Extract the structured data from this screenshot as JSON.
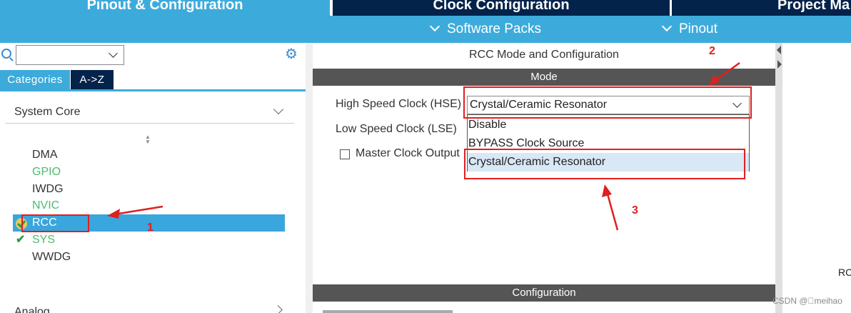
{
  "colors": {
    "nav_dark": "#03234b",
    "nav_blue": "#3cabdb",
    "selection": "#39a6dd",
    "tab_active": "#3cabdb",
    "tab_inactive": "#03234b",
    "bar_grey": "#555555",
    "enabled_green": "#4cba6e",
    "dd_highlight": "#d8e8f5",
    "annotation_red": "#e02020"
  },
  "top_tabs": [
    {
      "label": "Pinout & Configuration",
      "active": true
    },
    {
      "label": "Clock Configuration",
      "active": false
    },
    {
      "label": "Project Ma",
      "active": false
    }
  ],
  "sub_bar": {
    "software_packs": "Software Packs",
    "pinout": "Pinout"
  },
  "left_panel": {
    "search_value": "",
    "icons": {
      "search": "search-icon",
      "gear": "gear-icon"
    },
    "tabs": [
      {
        "label": "Categories"
      },
      {
        "label": "A->Z"
      }
    ],
    "category": "System Core",
    "peripherals": [
      {
        "label": "DMA",
        "status": "normal"
      },
      {
        "label": "GPIO",
        "status": "enabled"
      },
      {
        "label": "IWDG",
        "status": "normal"
      },
      {
        "label": "NVIC",
        "status": "enabled"
      },
      {
        "label": "RCC",
        "status": "selected"
      },
      {
        "label": "SYS",
        "status": "enabled"
      },
      {
        "label": "WWDG",
        "status": "normal"
      }
    ],
    "next_category": "Analog"
  },
  "center_panel": {
    "title": "RCC Mode and Configuration",
    "mode_header": "Mode",
    "hse_label": "High Speed Clock (HSE)",
    "hse_value": "Crystal/Ceramic Resonator",
    "lse_label": "Low Speed Clock (LSE)",
    "mco_label": "Master Clock Output",
    "mco_checked": false,
    "dropdown_options": [
      "Disable",
      "BYPASS Clock Source",
      "Crystal/Ceramic Resonator"
    ],
    "dropdown_highlighted": "Crystal/Ceramic Resonator",
    "config_header": "Configuration"
  },
  "right_panel": {
    "cut_text": "RC"
  },
  "annotations": {
    "n1": "1",
    "n2": "2",
    "n3": "3"
  },
  "watermark": "CSDN @\u0000meihao"
}
